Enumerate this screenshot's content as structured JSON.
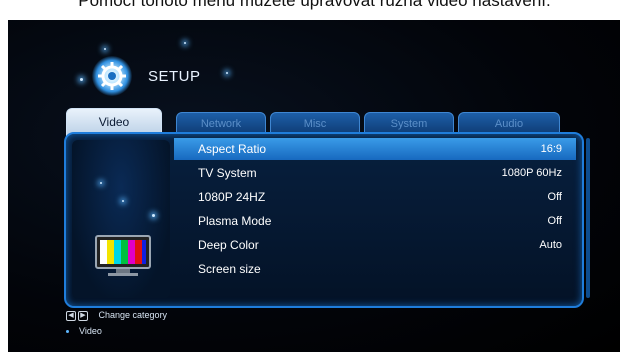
{
  "caption": "Pomocí tohoto menu můžete upravovat různá video nastavení.",
  "header": {
    "title": "SETUP",
    "icon": "gear-icon"
  },
  "tabs": [
    {
      "label": "Video",
      "active": true
    },
    {
      "label": "Network",
      "active": false
    },
    {
      "label": "Misc",
      "active": false
    },
    {
      "label": "System",
      "active": false
    },
    {
      "label": "Audio",
      "active": false
    }
  ],
  "settings": [
    {
      "label": "Aspect Ratio",
      "value": "16:9",
      "selected": true
    },
    {
      "label": "TV System",
      "value": "1080P 60Hz"
    },
    {
      "label": "1080P 24HZ",
      "value": "Off"
    },
    {
      "label": "Plasma Mode",
      "value": "Off"
    },
    {
      "label": "Deep Color",
      "value": "Auto"
    },
    {
      "label": "Screen size",
      "value": ""
    }
  ],
  "footer": {
    "hint": "Change category",
    "current": "Video"
  },
  "colors": {
    "accent": "#1f7ddb",
    "selected_row": "#2a86d8",
    "background": "#020409"
  }
}
